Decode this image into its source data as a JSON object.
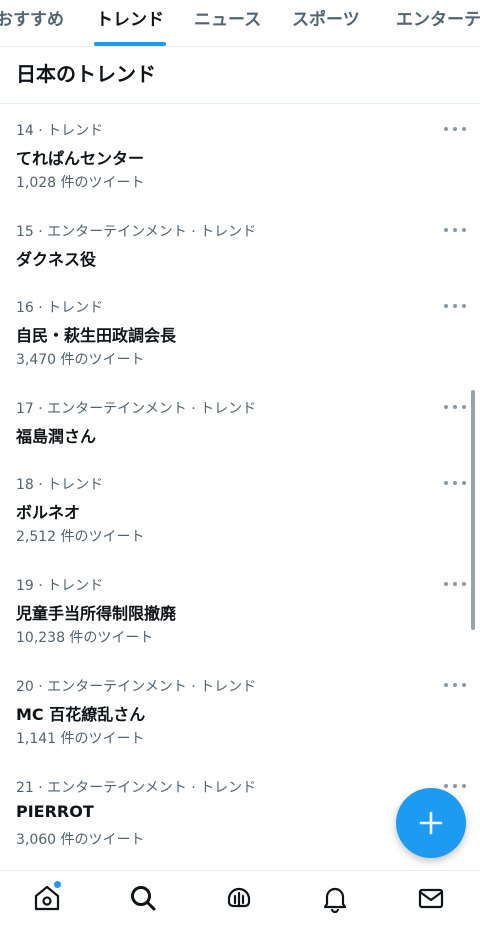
{
  "tabs": [
    {
      "label": "おすすめ",
      "active": false
    },
    {
      "label": "トレンド",
      "active": true
    },
    {
      "label": "ニュース",
      "active": false
    },
    {
      "label": "スポーツ",
      "active": false
    },
    {
      "label": "エンターテ",
      "active": false
    }
  ],
  "section": {
    "title": "日本のトレンド"
  },
  "trends": [
    {
      "meta": "14 · トレンド",
      "name": "てれぱんセンター",
      "count": "1,028 件のツイート"
    },
    {
      "meta": "15 · エンターテインメント · トレンド",
      "name": "ダクネス役",
      "count": ""
    },
    {
      "meta": "16 · トレンド",
      "name": "自民・萩生田政調会長",
      "count": "3,470 件のツイート"
    },
    {
      "meta": "17 · エンターテインメント · トレンド",
      "name": "福島潤さん",
      "count": ""
    },
    {
      "meta": "18 · トレンド",
      "name": "ボルネオ",
      "count": "2,512 件のツイート"
    },
    {
      "meta": "19 · トレンド",
      "name": "児童手当所得制限撤廃",
      "count": "10,238 件のツイート"
    },
    {
      "meta": "20 · エンターテインメント · トレンド",
      "name": "MC 百花繚乱さん",
      "count": "1,141 件のツイート"
    },
    {
      "meta": "21 · エンターテインメント · トレンド",
      "name": "PIERROT",
      "count": "3,060 件のツイート"
    }
  ],
  "icons": {
    "more": "more-horizontal-icon",
    "compose": "plus-icon",
    "nav": [
      "home-icon",
      "search-icon",
      "spaces-icon",
      "notifications-icon",
      "messages-icon"
    ]
  },
  "colors": {
    "accent": "#1d9bf0",
    "text": "#0f1419",
    "secondary": "#536471"
  }
}
